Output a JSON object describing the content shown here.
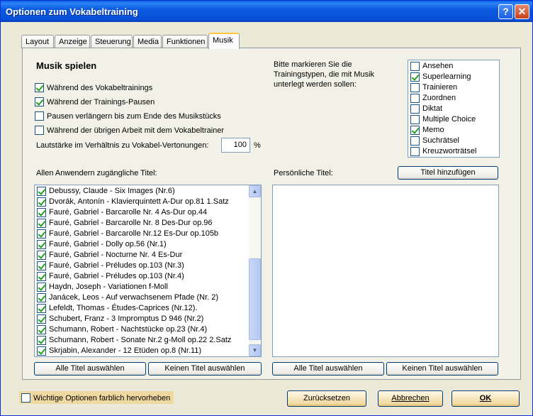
{
  "window": {
    "title": "Optionen zum Vokabeltraining",
    "help_label": "?",
    "close_label": "✕"
  },
  "tabs": [
    {
      "label": "Layout",
      "active": false
    },
    {
      "label": "Anzeige",
      "active": false
    },
    {
      "label": "Steuerung",
      "active": false
    },
    {
      "label": "Media",
      "active": false
    },
    {
      "label": "Funktionen",
      "active": false
    },
    {
      "label": "Musik",
      "active": true
    }
  ],
  "music": {
    "heading": "Musik spielen",
    "options": [
      {
        "label": "Während des Vokabeltrainings",
        "checked": true
      },
      {
        "label": "Während der Trainings-Pausen",
        "checked": true
      },
      {
        "label": "Pausen verlängern bis zum Ende des Musikstücks",
        "checked": false
      },
      {
        "label": "Während der übrigen Arbeit mit dem Vokabeltrainer",
        "checked": false
      }
    ],
    "volume_label": "Lautstärke im Verhältnis zu Vokabel-Vertonungen:",
    "volume_value": "100",
    "volume_unit": "%"
  },
  "training_types": {
    "prompt_lines": [
      "Bitte markieren Sie die",
      "Trainingstypen, die mit Musik",
      "unterlegt werden sollen:"
    ],
    "items": [
      {
        "label": "Ansehen",
        "checked": false
      },
      {
        "label": "Superlearning",
        "checked": true
      },
      {
        "label": "Trainieren",
        "checked": false
      },
      {
        "label": "Zuordnen",
        "checked": false
      },
      {
        "label": "Diktat",
        "checked": false
      },
      {
        "label": "Multiple Choice",
        "checked": false
      },
      {
        "label": "Memo",
        "checked": true
      },
      {
        "label": "Suchrätsel",
        "checked": false
      },
      {
        "label": "Kreuzworträtsel",
        "checked": false
      }
    ]
  },
  "all_titles": {
    "label": "Allen Anwendern zugängliche Titel:",
    "items": [
      {
        "label": "Debussy, Claude - Six Images (Nr.6)",
        "checked": true
      },
      {
        "label": "Dvorák, Antonín - Klavierquintett A-Dur op.81 1.Satz",
        "checked": true
      },
      {
        "label": "Fauré, Gabriel - Barcarolle Nr. 4 As-Dur op.44",
        "checked": true
      },
      {
        "label": "Fauré, Gabriel - Barcarolle Nr. 8 Des-Dur op.96",
        "checked": true
      },
      {
        "label": "Fauré, Gabriel - Barcarolle Nr.12 Es-Dur op.105b",
        "checked": true
      },
      {
        "label": "Fauré, Gabriel - Dolly op.56 (Nr.1)",
        "checked": true
      },
      {
        "label": "Fauré, Gabriel - Nocturne Nr. 4 Es-Dur",
        "checked": true
      },
      {
        "label": "Fauré, Gabriel - Préludes op.103 (Nr.3)",
        "checked": true
      },
      {
        "label": "Fauré, Gabriel - Préludes op.103 (Nr.4)",
        "checked": true
      },
      {
        "label": "Haydn, Joseph - Variationen f-Moll",
        "checked": true
      },
      {
        "label": "Janácek, Leos - Auf verwachsenem Pfade (Nr. 2)",
        "checked": true
      },
      {
        "label": "Lefeldt, Thomas - Études-Caprices (Nr.12).",
        "checked": true
      },
      {
        "label": "Schubert, Franz - 3 Impromptus D 946 (Nr.2)",
        "checked": true
      },
      {
        "label": "Schumann, Robert - Nachtstücke op.23 (Nr.4)",
        "checked": true
      },
      {
        "label": "Schumann, Robert - Sonate Nr.2 g-Moll op.22 2.Satz",
        "checked": true
      },
      {
        "label": "Skrjabin, Alexander - 12 Etüden op.8 (Nr.11)",
        "checked": true
      }
    ],
    "select_all": "Alle Titel auswählen",
    "select_none": "Keinen Titel auswählen"
  },
  "personal_titles": {
    "label": "Persönliche Titel:",
    "add_button": "Titel hinzufügen",
    "select_all": "Alle Titel auswählen",
    "select_none": "Keinen Titel auswählen"
  },
  "footer": {
    "highlight_label": "Wichtige Optionen farblich hervorheben",
    "highlight_checked": false,
    "reset_button": "Zurücksetzen",
    "cancel_button": "Abbrechen",
    "ok_button": "OK"
  },
  "colors": {
    "titlebar": "#0750d8",
    "highlight": "#f0d9a0",
    "check": "#21a121"
  }
}
